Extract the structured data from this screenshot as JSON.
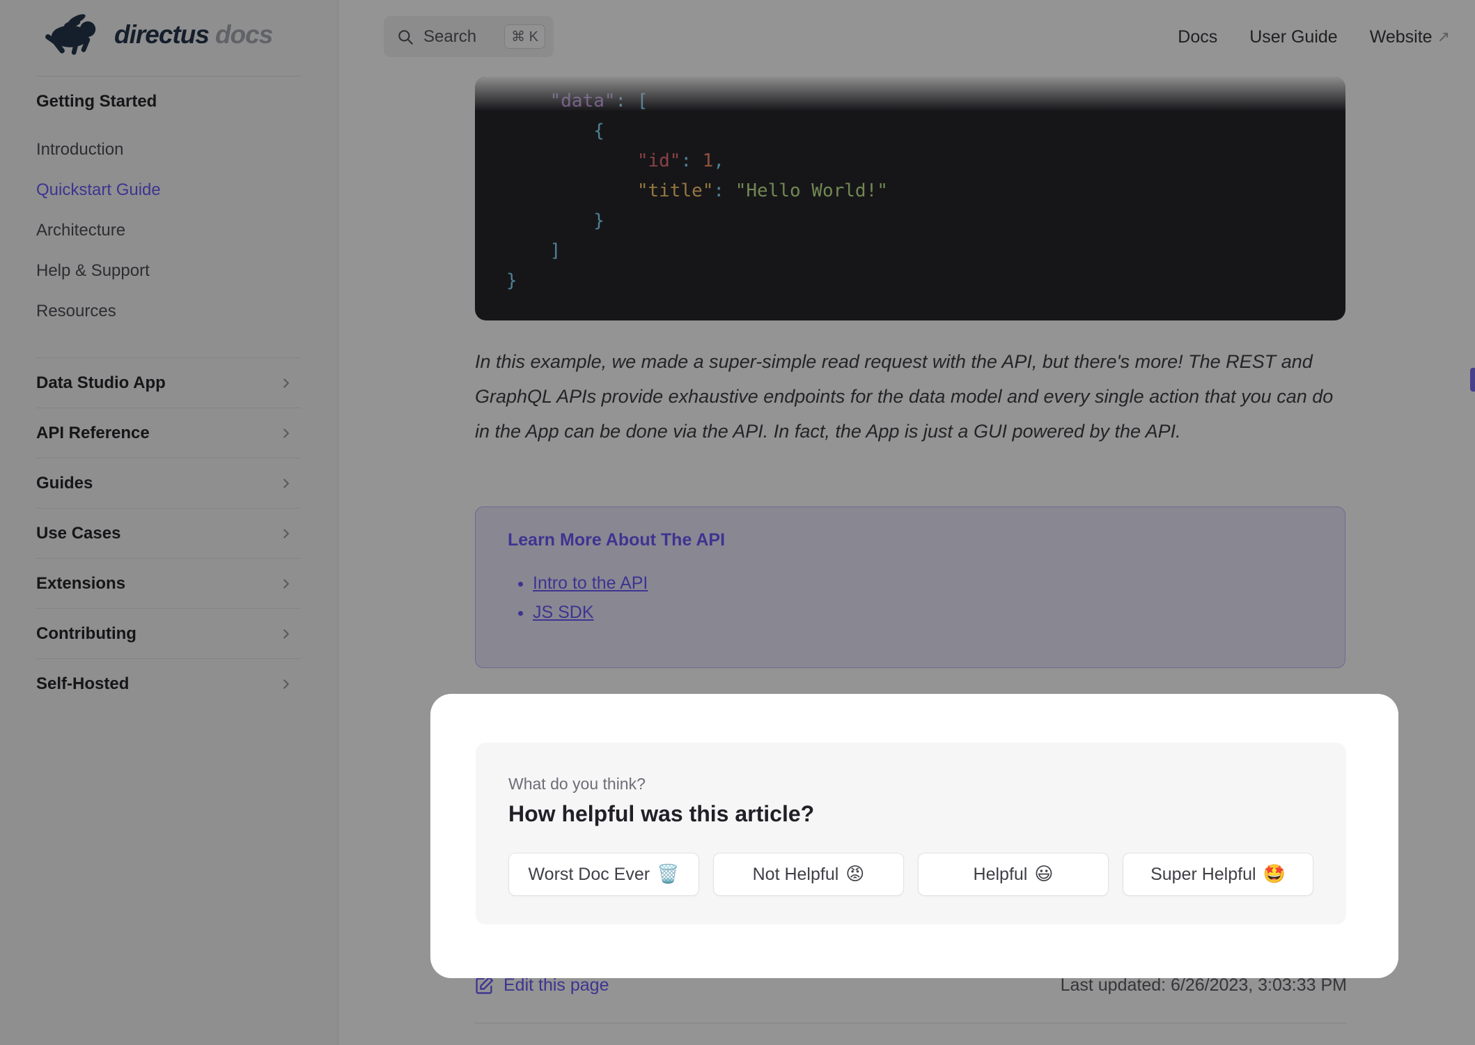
{
  "brand": {
    "name": "directus",
    "suffix": "docs"
  },
  "header": {
    "search": {
      "label": "Search",
      "shortcut": "⌘ K"
    },
    "nav": [
      {
        "label": "Docs"
      },
      {
        "label": "User Guide"
      },
      {
        "label": "Website",
        "external_mark": "↗"
      }
    ]
  },
  "sidebar": {
    "group_title": "Getting Started",
    "links": [
      {
        "label": "Introduction"
      },
      {
        "label": "Quickstart Guide",
        "active": true
      },
      {
        "label": "Architecture"
      },
      {
        "label": "Help & Support"
      },
      {
        "label": "Resources"
      }
    ],
    "sections": [
      {
        "label": "Data Studio App"
      },
      {
        "label": "API Reference"
      },
      {
        "label": "Guides"
      },
      {
        "label": "Use Cases"
      },
      {
        "label": "Extensions"
      },
      {
        "label": "Contributing"
      },
      {
        "label": "Self-Hosted"
      }
    ]
  },
  "code": {
    "l1_key": "    \"data\"",
    "l1_punct": ": [",
    "l2_punct": "        {",
    "l3_key": "            \"id\"",
    "l3_punct": ": ",
    "l3_num": "1",
    "l3_comma": ",",
    "l4_key": "            \"title\"",
    "l4_punct": ": ",
    "l4_str": "\"Hello World!\"",
    "l5_punct": "        }",
    "l6_punct": "    ]",
    "l7_punct": "}"
  },
  "article": {
    "paragraph": "In this example, we made a super-simple read request with the API, but there's more! The REST and GraphQL APIs provide exhaustive endpoints for the data model and every single action that you can do in the App can be done via the API. In fact, the App is just a GUI powered by the API.",
    "callout": {
      "title": "Learn More About The API",
      "links": [
        {
          "label": "Intro to the API"
        },
        {
          "label": "JS SDK"
        }
      ]
    }
  },
  "feedback": {
    "kicker": "What do you think?",
    "heading": "How helpful was this article?",
    "buttons": [
      {
        "label": "Worst Doc Ever",
        "emoji": "🗑️"
      },
      {
        "label": "Not Helpful",
        "emoji": "😡"
      },
      {
        "label": "Helpful",
        "emoji": "😃"
      },
      {
        "label": "Super Helpful",
        "emoji": "🤩"
      }
    ]
  },
  "footer": {
    "edit_label": "Edit this page",
    "last_updated": "Last updated: 6/26/2023, 3:03:33 PM"
  },
  "colors": {
    "accent": "#6a5bfa",
    "sidebar_bg": "#f6f6f7",
    "code_bg": "#26262b",
    "callout_bg": "#edeafb",
    "callout_border": "#beb5f6",
    "overlay": "rgba(0,0,0,0.42)",
    "code_tokens": {
      "key": "#c792ea",
      "key2": "#f07178",
      "key3": "#ffcb6b",
      "number": "#f78c6c",
      "string": "#c3e88d",
      "punctuation": "#89ddff"
    }
  }
}
